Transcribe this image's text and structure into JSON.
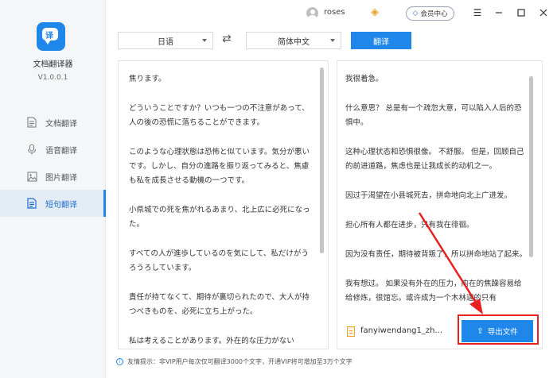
{
  "app": {
    "name": "文档翻译器",
    "version": "V1.0.0.1"
  },
  "sidebar": {
    "items": [
      {
        "label": "文档翻译",
        "icon": "document-icon",
        "active": false
      },
      {
        "label": "语音翻译",
        "icon": "microphone-icon",
        "active": false
      },
      {
        "label": "图片翻译",
        "icon": "image-icon",
        "active": false
      },
      {
        "label": "短句翻译",
        "icon": "short-text-icon",
        "active": true
      }
    ]
  },
  "topbar": {
    "username": "roses",
    "vip_center_label": "会员中心"
  },
  "toolbar": {
    "source_lang": "日语",
    "target_lang": "简体中文",
    "translate_label": "翻译"
  },
  "source": {
    "paragraphs": [
      "焦ります。",
      "どういうことですか？いつも一つの不注意があって、人の後の恐慌に落ちることができます。",
      "このような心理状態は恐怖と似ています。気分が悪いです。しかし、自分の進路を振り返ってみると、焦慮も私を成長させる動機の一つです。",
      "小県城での死を焦がれるあまり、北上広に必死になった。",
      "すべての人が進歩しているのを気にして、私だけがうろうろしています。",
      "責任が持てなくて、期待が裏切られたので、大人が持つべきものを、必死に立ち上がった。",
      "私は考えることがあります。外在的な圧力がない"
    ]
  },
  "target": {
    "paragraphs": [
      "我很着急。",
      "什么意思？ 总是有一个疏忽大意，可以陷入人后的恐惧中。",
      "这种心理状态和恐惧很像。 不舒服。 但是，回顾自己的前进道路，焦虑也是让我成长的动机之一。",
      "因过于渴望在小县城死去，拼命地向北上广进发。",
      "担心所有人都在进步，只有我在徘徊。",
      "因为没有责任，期待被背叛了，所以拼命地站了起来。",
      "我有想过。 如果没有外在的压力，内在的焦躁容易给给修炼，很馆忘。或许成为一个木林迦的只有"
    ]
  },
  "file": {
    "name": "fanyiwendang1_zh...",
    "export_label": "导出文件"
  },
  "footer": {
    "tip": "友情提示：非VIP用户每次仅可翻译3000个文字，开通VIP将可增加至3万个文字"
  },
  "colors": {
    "accent": "#1f86ea",
    "highlight": "#e8211f",
    "vip_gold": "#e6a020"
  }
}
